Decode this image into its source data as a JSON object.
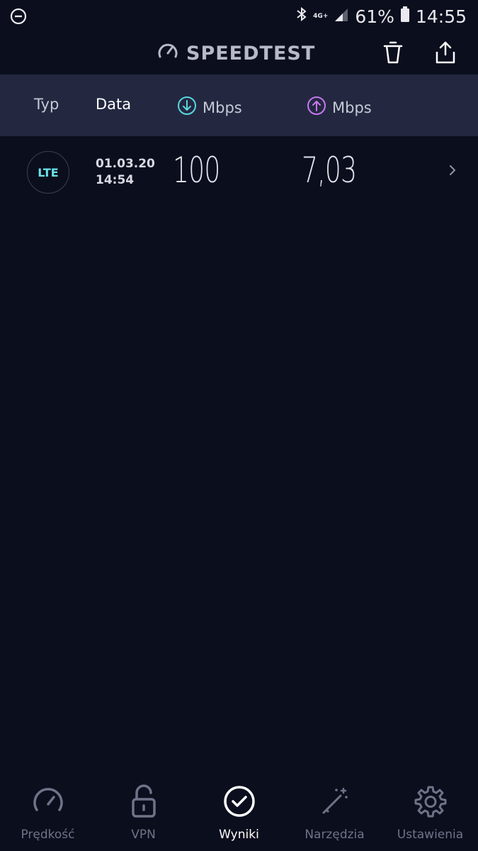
{
  "status_bar": {
    "dnd_icon": "do-not-disturb-icon",
    "bluetooth_icon": "bluetooth-icon",
    "network": "4G+",
    "battery": "61%",
    "time": "14:55"
  },
  "app_bar": {
    "title": "SPEEDTEST",
    "delete_icon": "trash-icon",
    "share_icon": "share-icon"
  },
  "columns": {
    "type": "Typ",
    "date": "Data",
    "download_unit": "Mbps",
    "upload_unit": "Mbps"
  },
  "results": [
    {
      "type": "LTE",
      "date": "01.03.20",
      "time": "14:54",
      "download": "100",
      "upload": "7,03"
    }
  ],
  "nav": {
    "items": [
      {
        "label": "Prędkość",
        "icon": "speedometer-icon"
      },
      {
        "label": "VPN",
        "icon": "lock-icon"
      },
      {
        "label": "Wyniki",
        "icon": "check-circle-icon"
      },
      {
        "label": "Narzędzia",
        "icon": "magic-wand-icon"
      },
      {
        "label": "Ustawienia",
        "icon": "gear-icon"
      }
    ],
    "active_index": 2
  },
  "colors": {
    "background": "#0b0e1d",
    "header_bg": "#232840",
    "download_accent": "#5ad7e0",
    "upload_accent": "#c778f0",
    "lte_accent": "#6be3e8"
  }
}
